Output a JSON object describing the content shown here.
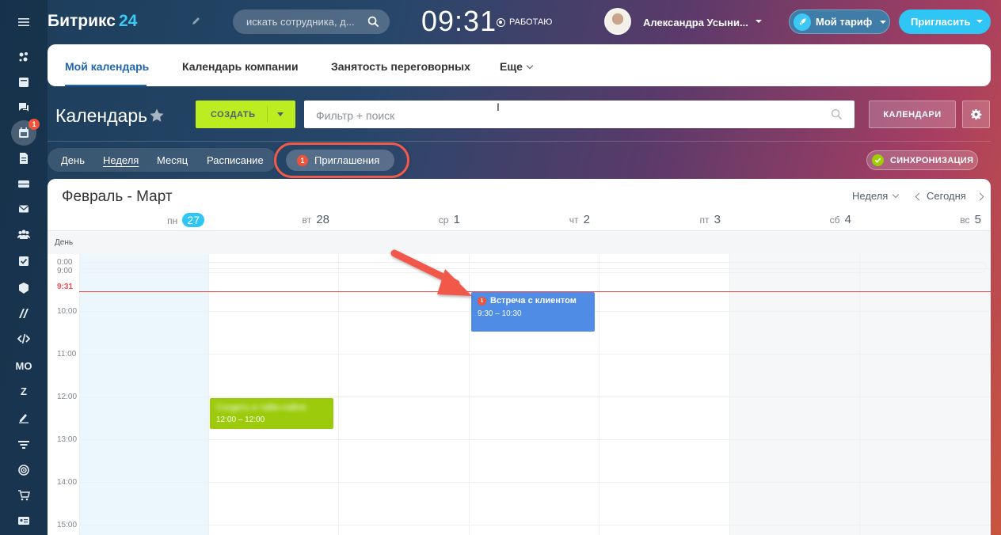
{
  "sidebar": {
    "items": [
      {
        "icon": "menu-icon"
      },
      {
        "icon": "feed-icon"
      },
      {
        "icon": "tasks-icon"
      },
      {
        "icon": "chat-icon"
      },
      {
        "icon": "calendar-icon",
        "badge": "1"
      },
      {
        "icon": "document-icon"
      },
      {
        "icon": "drive-icon"
      },
      {
        "icon": "mail-icon"
      },
      {
        "icon": "people-icon"
      },
      {
        "icon": "checkbox-icon"
      },
      {
        "icon": "cube-icon"
      },
      {
        "icon": "slash-icon"
      },
      {
        "icon": "code-icon"
      },
      {
        "label": "МО"
      },
      {
        "label": "Z"
      },
      {
        "icon": "signature-icon"
      },
      {
        "icon": "filter-icon"
      },
      {
        "icon": "target-icon"
      },
      {
        "icon": "cart-icon"
      },
      {
        "icon": "card-icon"
      }
    ]
  },
  "header": {
    "logo_text": "Битрикс",
    "logo_num": "24",
    "search_placeholder": "искать сотрудника, д...",
    "clock": "09:31",
    "work_status": "РАБОТАЮ",
    "user_name": "Александра Усыни...",
    "tariff_label": "Мой тариф",
    "invite_label": "Пригласить"
  },
  "tabs": {
    "items": [
      "Мой календарь",
      "Календарь компании",
      "Занятость переговорных",
      "Еще"
    ]
  },
  "toolbar": {
    "title": "Календарь",
    "create_label": "СОЗДАТЬ",
    "filter_placeholder": "Фильтр + поиск",
    "calendars_label": "КАЛЕНДАРИ"
  },
  "views": {
    "items": [
      "День",
      "Неделя",
      "Месяц",
      "Расписание"
    ],
    "invitations_label": "Приглашения",
    "invitations_count": "1",
    "sync_label": "СИНХРОНИЗАЦИЯ"
  },
  "calendar": {
    "period_title": "Февраль - Март",
    "view_select": "Неделя",
    "today_label": "Сегодня",
    "days": [
      {
        "dow": "пн",
        "num": "27"
      },
      {
        "dow": "вт",
        "num": "28"
      },
      {
        "dow": "ср",
        "num": "1"
      },
      {
        "dow": "чт",
        "num": "2"
      },
      {
        "dow": "пт",
        "num": "3"
      },
      {
        "dow": "сб",
        "num": "4"
      },
      {
        "dow": "вс",
        "num": "5"
      }
    ],
    "allday_label": "День",
    "hours": [
      "0:00",
      "9:00",
      "10:00",
      "11:00",
      "12:00",
      "13:00",
      "14:00",
      "15:00"
    ],
    "now_label": "9:31",
    "events": [
      {
        "title": "Встреча с клиентом",
        "time": "9:30 – 10:30",
        "badge": "1",
        "color": "#4e8ce5"
      },
      {
        "title": "Сходить в тайм-лайне",
        "time": "12:00 – 12:00",
        "color": "#9bcb0b"
      }
    ]
  },
  "colors": {
    "accent": "#2fc6f6",
    "create_green": "#bbed21",
    "badge_red": "#f0523a",
    "now_line": "#f05050",
    "highlight_outline": "#ef5a4a"
  }
}
